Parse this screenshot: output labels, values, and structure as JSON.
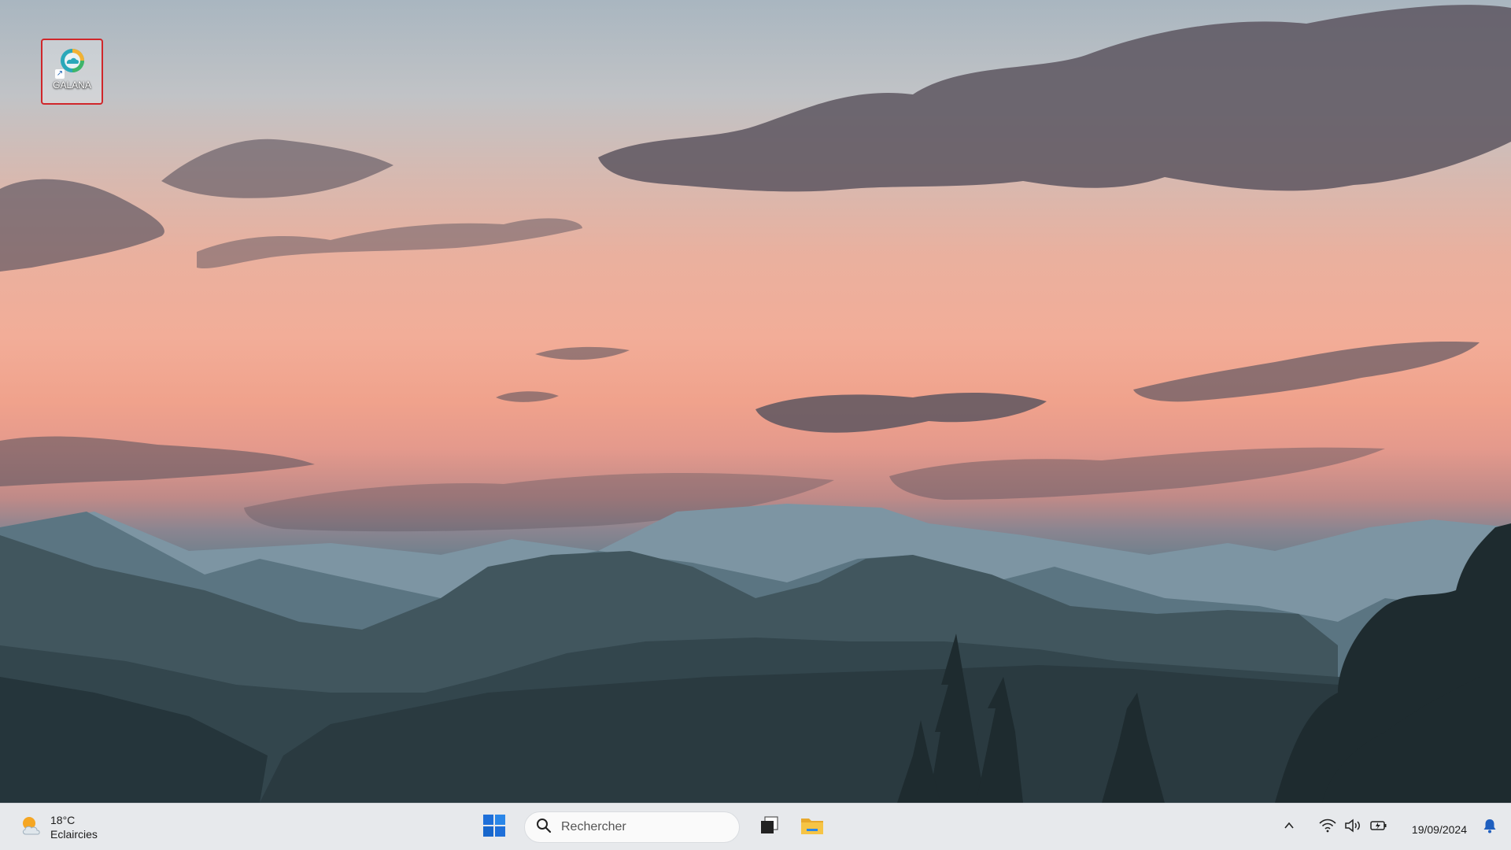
{
  "desktop": {
    "icons": [
      {
        "label": "GALANA",
        "icon": "galana-cloud-icon"
      }
    ]
  },
  "taskbar": {
    "weather": {
      "temperature": "18°C",
      "condition": "Eclaircies",
      "icon": "partly-sunny-icon"
    },
    "start_icon": "windows-logo-icon",
    "search": {
      "placeholder": "Rechercher",
      "icon": "search-icon"
    },
    "pinned": [
      {
        "name": "task-view",
        "icon": "task-view-icon"
      },
      {
        "name": "file-explorer",
        "icon": "folder-icon"
      }
    ],
    "tray": {
      "chevron_icon": "chevron-up-icon",
      "wifi_icon": "wifi-icon",
      "volume_icon": "speaker-icon",
      "battery_icon": "battery-charging-icon",
      "date": "19/09/2024",
      "notification_icon": "bell-icon"
    }
  },
  "colors": {
    "taskbar_bg": "#e7e9ec",
    "windows_blue": "#1e6fd9",
    "folder_yellow": "#f6c445",
    "selection_border": "#d0262a"
  }
}
